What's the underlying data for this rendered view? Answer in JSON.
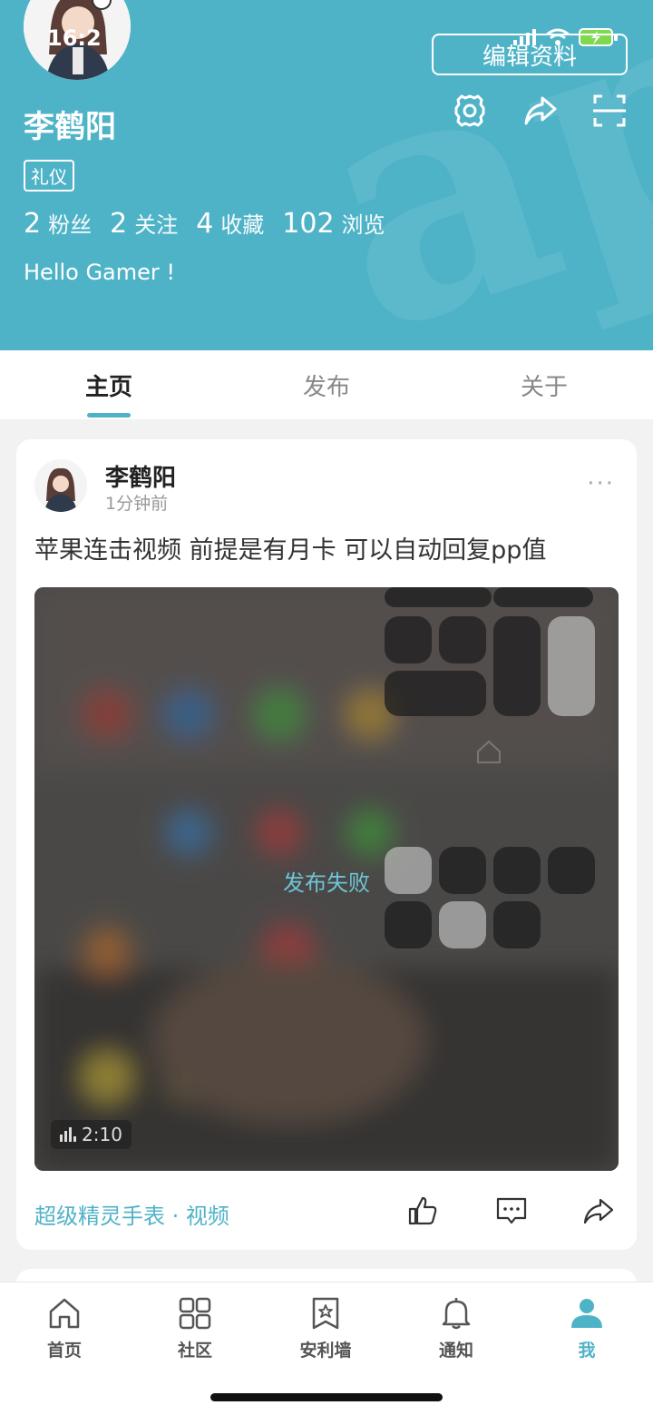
{
  "status_bar": {
    "time": "16:2"
  },
  "profile": {
    "name": "李鹤阳",
    "tag": "礼仪",
    "edit_label": "编辑资料",
    "stats": [
      {
        "num": "2",
        "label": "粉丝"
      },
      {
        "num": "2",
        "label": "关注"
      },
      {
        "num": "4",
        "label": "收藏"
      },
      {
        "num": "102",
        "label": "浏览"
      }
    ],
    "bio": "Hello Gamer !"
  },
  "tabs": [
    {
      "label": "主页",
      "active": true
    },
    {
      "label": "发布",
      "active": false
    },
    {
      "label": "关于",
      "active": false
    }
  ],
  "post": {
    "author": "李鹤阳",
    "time": "1分钟前",
    "more": "···",
    "text": "苹果连击视频 前提是有月卡 可以自动回复pp值",
    "status": "发布失败",
    "duration": "2:10",
    "footer_tag": "超级精灵手表 · 视频"
  },
  "nav": [
    {
      "label": "首页",
      "icon": "home-icon"
    },
    {
      "label": "社区",
      "icon": "grid-icon"
    },
    {
      "label": "安利墙",
      "icon": "bookmark-star-icon"
    },
    {
      "label": "通知",
      "icon": "bell-icon"
    },
    {
      "label": "我",
      "icon": "person-icon"
    }
  ],
  "colors": {
    "accent": "#4fb3c8",
    "header_bg": "#4fb3c8"
  }
}
